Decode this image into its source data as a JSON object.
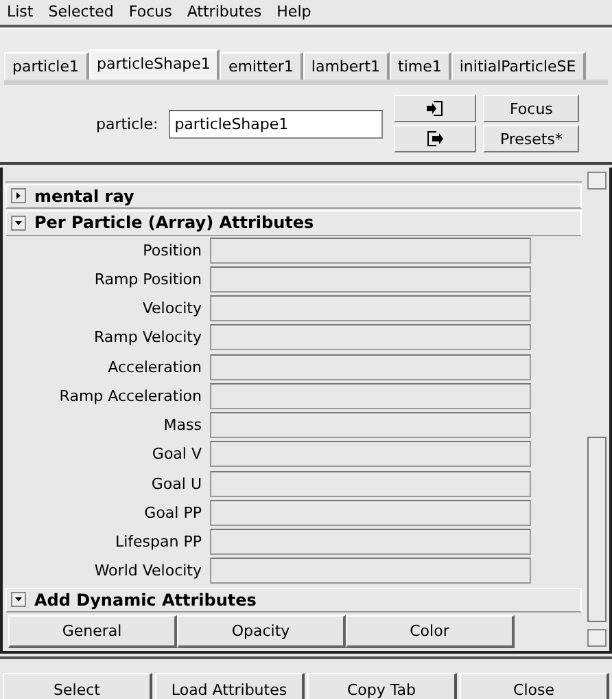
{
  "menu": [
    "List",
    "Selected",
    "Focus",
    "Attributes",
    "Help"
  ],
  "tabs": [
    {
      "label": "particle1",
      "selected": false
    },
    {
      "label": "particleShape1",
      "selected": true
    },
    {
      "label": "emitter1",
      "selected": false
    },
    {
      "label": "lambert1",
      "selected": false
    },
    {
      "label": "time1",
      "selected": false
    },
    {
      "label": "initialParticleSE",
      "selected": false
    }
  ],
  "node": {
    "label": "particle:",
    "value": "particleShape1",
    "buttons": [
      "Focus",
      "Presets*"
    ]
  },
  "sections": [
    {
      "title": "mental ray",
      "expanded": false
    },
    {
      "title": "Per Particle (Array) Attributes",
      "expanded": true,
      "fields": [
        "Position",
        "Ramp Position",
        "Velocity",
        "Ramp Velocity",
        "Acceleration",
        "Ramp Acceleration",
        "Mass",
        "Goal V",
        "Goal U",
        "Goal PP",
        "Lifespan PP",
        "World Velocity"
      ]
    },
    {
      "title": "Add Dynamic Attributes",
      "expanded": true,
      "buttons": [
        "General",
        "Opacity",
        "Color"
      ]
    }
  ],
  "bottom_buttons": [
    "Select",
    "Load Attributes",
    "Copy Tab",
    "Close"
  ]
}
